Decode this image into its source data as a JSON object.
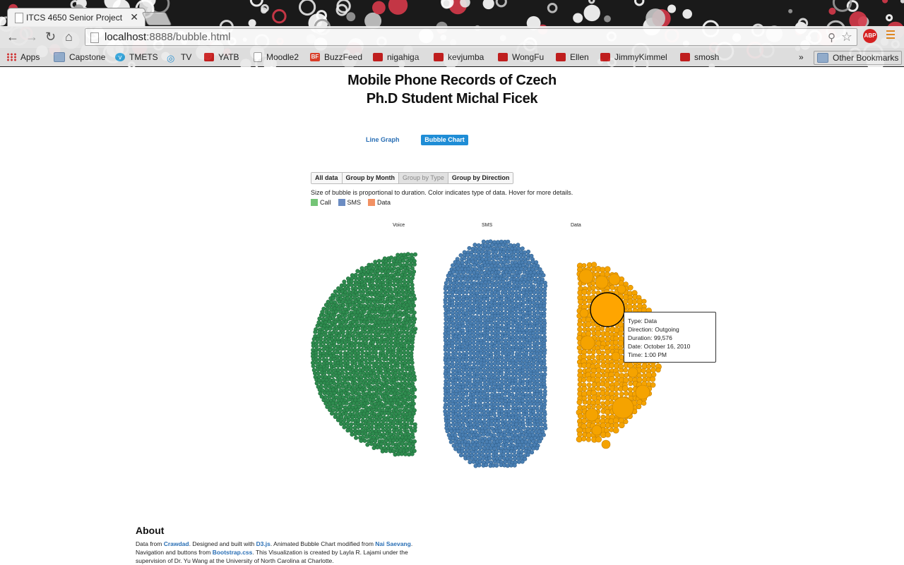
{
  "browser": {
    "tab_title": "ITCS 4650 Senior Project",
    "close_glyph": "✕",
    "url_host": "localhost",
    "url_path": ":8888/bubble.html",
    "abp_label": "ABP",
    "bookmarks": [
      {
        "label": "Apps",
        "icon": "apps-icon"
      },
      {
        "label": "Capstone",
        "icon": "folder-icon"
      },
      {
        "label": "TMETS",
        "icon": "vimeo-icon"
      },
      {
        "label": "TV",
        "icon": "tv-icon"
      },
      {
        "label": "YATB",
        "icon": "youtube-icon"
      },
      {
        "label": "Moodle2",
        "icon": "page-icon"
      },
      {
        "label": "BuzzFeed",
        "icon": "buzzfeed-icon"
      },
      {
        "label": "nigahiga",
        "icon": "youtube-icon"
      },
      {
        "label": "kevjumba",
        "icon": "youtube-icon"
      },
      {
        "label": "WongFu",
        "icon": "youtube-icon"
      },
      {
        "label": "Ellen",
        "icon": "youtube-icon"
      },
      {
        "label": "JimmyKimmel",
        "icon": "youtube-icon"
      },
      {
        "label": "smosh",
        "icon": "youtube-icon"
      }
    ],
    "overflow_label": "»",
    "other_bookmarks": "Other Bookmarks"
  },
  "page": {
    "title_line1": "Mobile Phone Records of Czech",
    "title_line2": "Ph.D Student Michal Ficek",
    "nav": {
      "line_graph": "Line Graph",
      "bubble_chart": "Bubble Chart"
    },
    "group_buttons": [
      "All data",
      "Group by Month",
      "Group by Type",
      "Group by Direction"
    ],
    "active_group": "Group by Type",
    "caption": "Size of bubble is proportional to duration. Color indicates type of data. Hover for more details.",
    "legend": [
      {
        "label": "Call",
        "color": "#74c476"
      },
      {
        "label": "SMS",
        "color": "#6b8cc2"
      },
      {
        "label": "Data",
        "color": "#f29163"
      }
    ],
    "group_labels": [
      "Voice",
      "SMS",
      "Data"
    ],
    "tooltip": [
      "Type: Data",
      "Direction: Outgoing",
      "Duration: 99,576",
      "Date: October 16, 2010",
      "Time: 1:00 PM"
    ],
    "about_title": "About",
    "about": {
      "t1": "Data from ",
      "l1": "Crawdad",
      "t2": ". Designed and built with ",
      "l2": "D3.js",
      "t3": ". Animated Bubble Chart modified from ",
      "l3": "Nai Saevang",
      "t4": ". Navigation and buttons from ",
      "l4": "Bootstrap.css",
      "t5": ". This Visualization is created by Layla R. Lajami under the supervision of Dr. Yu Wang at the University of North Carolina at Charlotte."
    }
  },
  "colors": {
    "voice": "#2e8b4e",
    "sms": "#4a7fb3",
    "data": "#f5a300",
    "voice_stroke": "#1f6b3a",
    "sms_stroke": "#2f5f8c",
    "data_stroke": "#c47f00"
  }
}
